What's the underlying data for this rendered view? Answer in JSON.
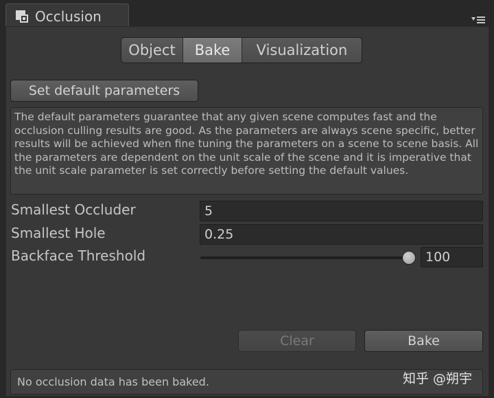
{
  "window": {
    "title": "Occlusion",
    "icon": "occlusion-window-icon",
    "menu_icon": "tab-menu-icon"
  },
  "tabs": [
    {
      "label": "Object",
      "active": false
    },
    {
      "label": "Bake",
      "active": true
    },
    {
      "label": "Visualization",
      "active": false
    }
  ],
  "set_default_button": "Set default parameters",
  "help_text": "The default parameters guarantee that any given scene computes fast and the occlusion culling results are good. As the parameters are always scene specific, better results will be achieved when fine tuning the parameters on a scene to scene basis. All the parameters are dependent on the unit scale of the scene and it is imperative that the unit scale parameter is set correctly before setting the default values.",
  "fields": {
    "smallest_occluder": {
      "label": "Smallest Occluder",
      "value": "5"
    },
    "smallest_hole": {
      "label": "Smallest Hole",
      "value": "0.25"
    },
    "backface_threshold": {
      "label": "Backface Threshold",
      "value": "100",
      "slider_fraction": 1.0
    }
  },
  "buttons": {
    "clear": "Clear",
    "bake": "Bake"
  },
  "status": "No occlusion data has been baked.",
  "watermark": "知乎 @朔宇"
}
